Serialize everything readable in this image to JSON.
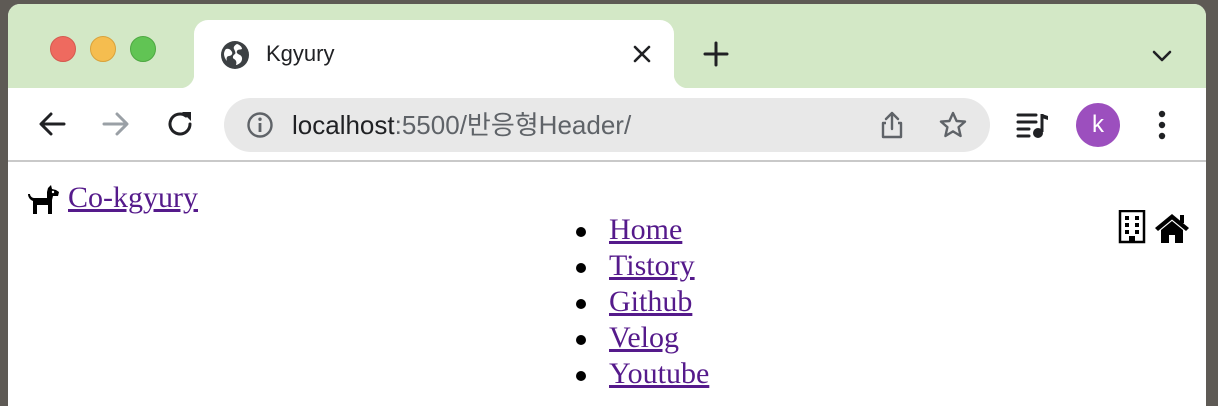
{
  "browser": {
    "tab": {
      "title": "Kgyury",
      "favicon": "globe-icon"
    },
    "address_bar": {
      "host": "localhost",
      "rest": ":5500/반응형Header/"
    },
    "profile_initial": "k",
    "colors": {
      "tabstrip": "#d3e8c6",
      "avatar": "#9c4fbe",
      "link": "#551a8b"
    }
  },
  "page": {
    "brand": {
      "icon": "dog-icon",
      "label": "Co-kgyury"
    },
    "nav_items": [
      {
        "label": "Home"
      },
      {
        "label": "Tistory"
      },
      {
        "label": "Github"
      },
      {
        "label": "Velog"
      },
      {
        "label": "Youtube"
      }
    ],
    "right_icons": [
      "building-icon",
      "home-icon"
    ]
  }
}
